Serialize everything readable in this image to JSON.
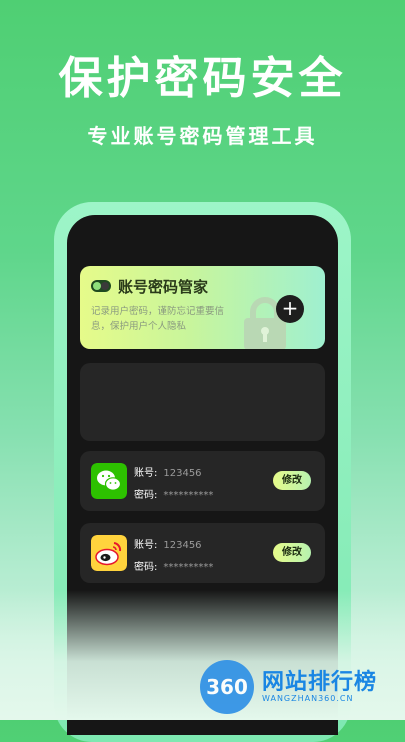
{
  "promo": {
    "headline": "保护密码安全",
    "subline": "专业账号密码管理工具"
  },
  "app": {
    "hero": {
      "title": "账号密码管家",
      "description": "记录用户密码，谨防忘记重要信息，保护用户个人隐私",
      "add_symbol": "+"
    },
    "accounts": [
      {
        "app_icon": "wechat-icon",
        "account_label": "账号:",
        "account_value": "123456",
        "password_label": "密码:",
        "password_value": "**********",
        "edit_label": "修改"
      },
      {
        "app_icon": "weibo-icon",
        "account_label": "账号:",
        "account_value": "123456",
        "password_label": "密码:",
        "password_value": "**********",
        "edit_label": "修改"
      }
    ]
  },
  "watermark": {
    "logo_text": "360",
    "site_name": "网站排行榜",
    "site_domain": "WANGZHAN360.CN"
  },
  "colors": {
    "brand_green": "#4fcf73",
    "card_gradient_start": "#e6fb8a",
    "card_gradient_end": "#9ff0d0",
    "screen_bg": "#161616",
    "watermark_blue": "#1a86e3"
  }
}
